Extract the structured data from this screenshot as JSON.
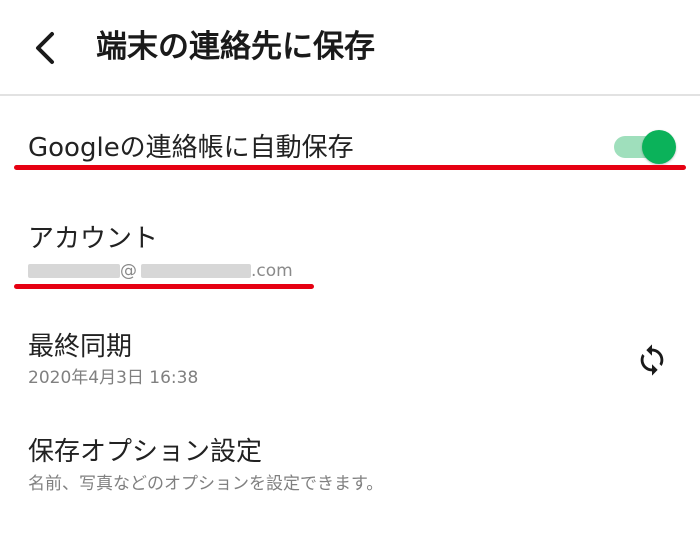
{
  "header": {
    "title": "端末の連絡先に保存"
  },
  "auto_save": {
    "label": "Googleの連絡帳に自動保存",
    "enabled": true,
    "toggle_color": "#0bb25a"
  },
  "account": {
    "label": "アカウント",
    "email_visible": "@",
    "email_domain": ".com"
  },
  "last_sync": {
    "label": "最終同期",
    "value": "2020年4月3日 16:38"
  },
  "save_options": {
    "label": "保存オプション設定",
    "description": "名前、写真などのオプションを設定できます。"
  },
  "annotation_color": "#e60012"
}
